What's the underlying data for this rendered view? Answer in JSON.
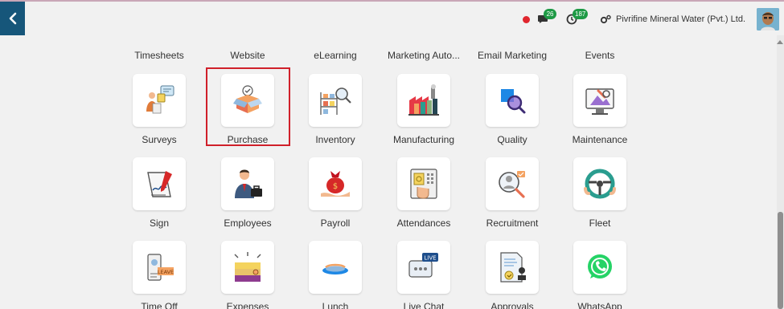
{
  "topbar": {
    "messages_count": "26",
    "activities_count": "187",
    "company_name": "Pivrifine Mineral Water (Pvt.) Ltd."
  },
  "top_row": [
    "Timesheets",
    "Website",
    "eLearning",
    "Marketing Auto...",
    "Email Marketing",
    "Events"
  ],
  "apps": {
    "row1": [
      "Surveys",
      "Purchase",
      "Inventory",
      "Manufacturing",
      "Quality",
      "Maintenance"
    ],
    "row2": [
      "Sign",
      "Employees",
      "Payroll",
      "Attendances",
      "Recruitment",
      "Fleet"
    ],
    "row3": [
      "Time Off",
      "Expenses",
      "Lunch",
      "Live Chat",
      "Approvals",
      "WhatsApp"
    ]
  },
  "icons": {
    "row1": [
      "surveys-icon",
      "purchase-icon",
      "inventory-icon",
      "manufacturing-icon",
      "quality-icon",
      "maintenance-icon"
    ],
    "row2": [
      "sign-icon",
      "employees-icon",
      "payroll-icon",
      "attendances-icon",
      "recruitment-icon",
      "fleet-icon"
    ],
    "row3": [
      "time-off-icon",
      "expenses-icon",
      "lunch-icon",
      "live-chat-icon",
      "approvals-icon",
      "whatsapp-icon"
    ]
  },
  "colors": {
    "back_button": "#16567a",
    "badge": "#1e9a45",
    "highlight": "#d0202a",
    "status_dot": "#e0262e"
  }
}
